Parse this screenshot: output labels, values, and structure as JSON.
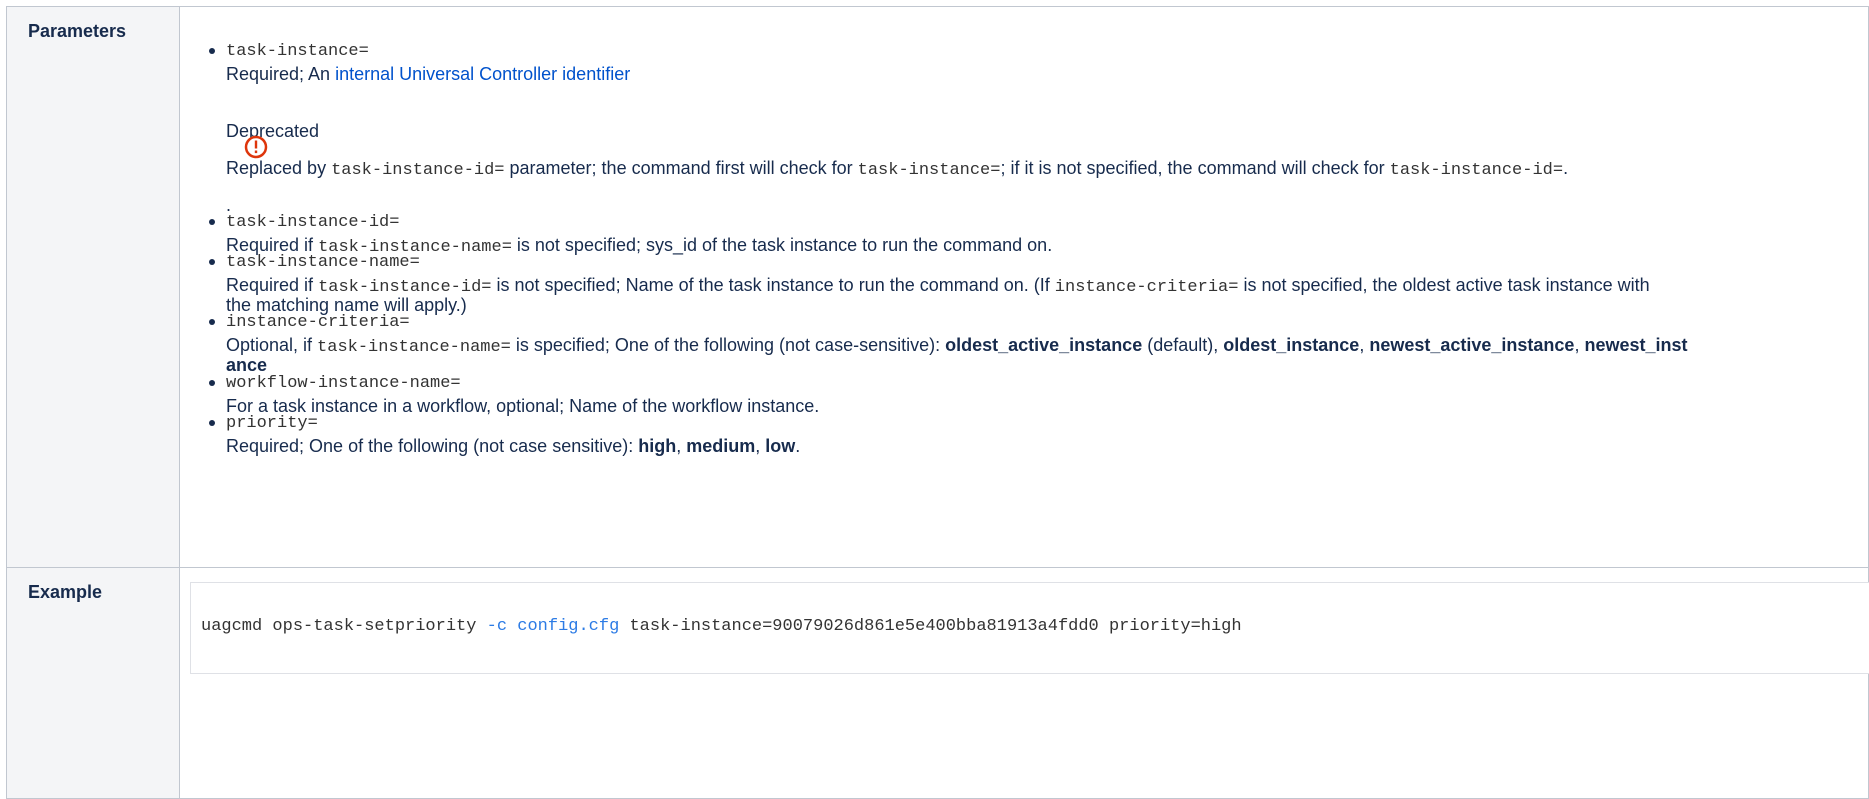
{
  "parameters": {
    "header": "Parameters",
    "items": [
      {
        "name": "task-instance=",
        "desc_prefix": "Required; An ",
        "desc_link": "internal Universal Controller identifier",
        "deprecated_title": "Deprecated",
        "deprecated_text_1": "Replaced by ",
        "deprecated_code_1": "task-instance-id=",
        "deprecated_text_2": " parameter; the command first will check for ",
        "deprecated_code_2": "task-instance=",
        "deprecated_text_3": "; if it is not specified, the command will check for ",
        "deprecated_code_3": "task-instance-id=",
        "deprecated_text_4": ".",
        "period": "."
      },
      {
        "name": "task-instance-id=",
        "desc_1": "Required if ",
        "code_1": "task-instance-name=",
        "desc_2": " is not specified; sys_id of the task instance to run the command on."
      },
      {
        "name": "task-instance-name=",
        "desc_1": "Required if ",
        "code_1": "task-instance-id=",
        "desc_2": " is not specified; Name of the task instance to run the command on. (If ",
        "code_2": "instance-criteria=",
        "desc_3": " is not specified, the oldest active task instance with",
        "desc_line2": "the matching name will apply.)"
      },
      {
        "name": "instance-criteria=",
        "desc_1": "Optional, if ",
        "code_1": "task-instance-name=",
        "desc_2": " is specified; One of the following (not case-sensitive): ",
        "bold_1": "oldest_active_instance",
        "desc_3": " (default), ",
        "bold_2": "oldest_instance",
        "sep_1": ", ",
        "bold_3": "newest_active_instance",
        "sep_2": ", ",
        "bold_4a": "newest_inst",
        "bold_4b": "ance"
      },
      {
        "name": "workflow-instance-name=",
        "desc": "For a task instance in a workflow, optional; Name of the workflow instance."
      },
      {
        "name": "priority=",
        "desc_1": "Required; One of the following (not case sensitive): ",
        "bold_1": "high",
        "sep_1": ", ",
        "bold_2": "medium",
        "sep_2": ", ",
        "bold_3": "low",
        "end": "."
      }
    ]
  },
  "example": {
    "header": "Example",
    "cmd": "uagcmd ops-task-setpriority ",
    "opt": "-c config.cfg",
    "rest": " task-instance=90079026d861e5e400bba81913a4fdd0 priority=high"
  },
  "icons": {
    "warning": "warning-icon"
  },
  "colors": {
    "link": "#0052cc",
    "warning": "#de350b",
    "header_bg": "#f4f5f7"
  }
}
